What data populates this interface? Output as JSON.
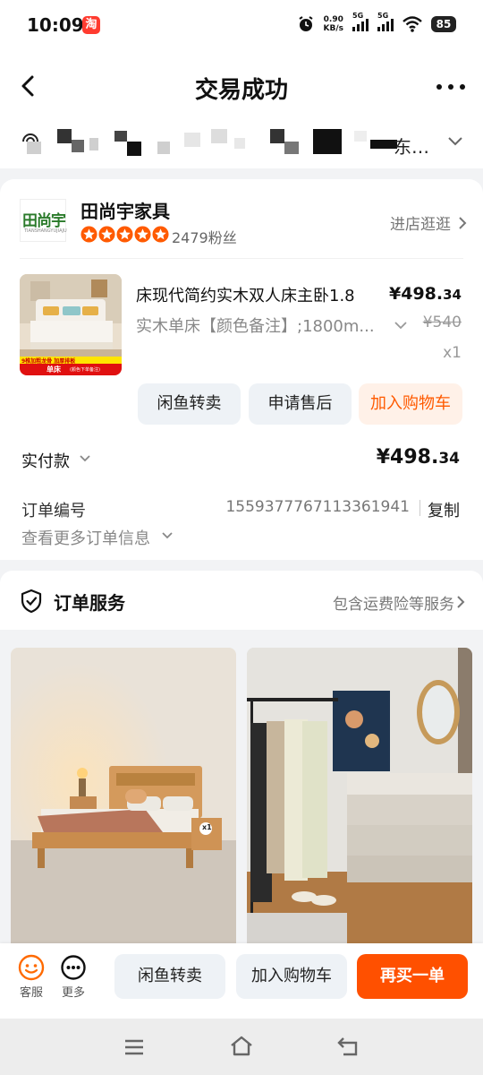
{
  "status_bar": {
    "time": "10:09",
    "app_badge": "淘",
    "net_speed_value": "0.90",
    "net_speed_unit": "KB/s",
    "signal1_label": "5G",
    "signal2_label": "5G",
    "battery": "85"
  },
  "header": {
    "title": "交易成功"
  },
  "address": {
    "visible_text": "东…"
  },
  "store": {
    "logo_text": "田尚宇",
    "logo_sub": "TIANSHANGYUJIAJU",
    "name": "田尚宇家具",
    "rating_stars": 5,
    "fans": "2479粉丝",
    "visit_label": "进店逛逛"
  },
  "product": {
    "title": "床现代简约实木双人床主卧1.8",
    "price_main": "¥498.",
    "price_decimal": "34",
    "spec": "实木单床【颜色备注】;1800m...",
    "original_price": "¥540",
    "quantity": "x1",
    "thumb_banner": "9椎加粗龙骨 加厚排板",
    "thumb_tag": "单床",
    "thumb_tag_note": "(颜色下单备注)"
  },
  "product_actions": {
    "resell": "闲鱼转卖",
    "after_sale": "申请售后",
    "add_cart": "加入购物车"
  },
  "payment": {
    "label": "实付款",
    "amount_main": "¥498.",
    "amount_decimal": "34"
  },
  "order": {
    "number_label": "订单编号",
    "number": "1559377767113361941",
    "copy_label": "复制",
    "more_info": "查看更多订单信息"
  },
  "service": {
    "title": "订单服务",
    "link": "包含运费险等服务"
  },
  "recommend": {
    "badge": "x1"
  },
  "action_bar": {
    "support_label": "客服",
    "more_label": "更多",
    "resell": "闲鱼转卖",
    "add_cart": "加入购物车",
    "buy_again": "再买一单"
  },
  "colors": {
    "accent": "#ff5000",
    "accent_light_bg": "#fff1e8",
    "star": "#ff5a00",
    "button_bg": "#eef2f6"
  }
}
